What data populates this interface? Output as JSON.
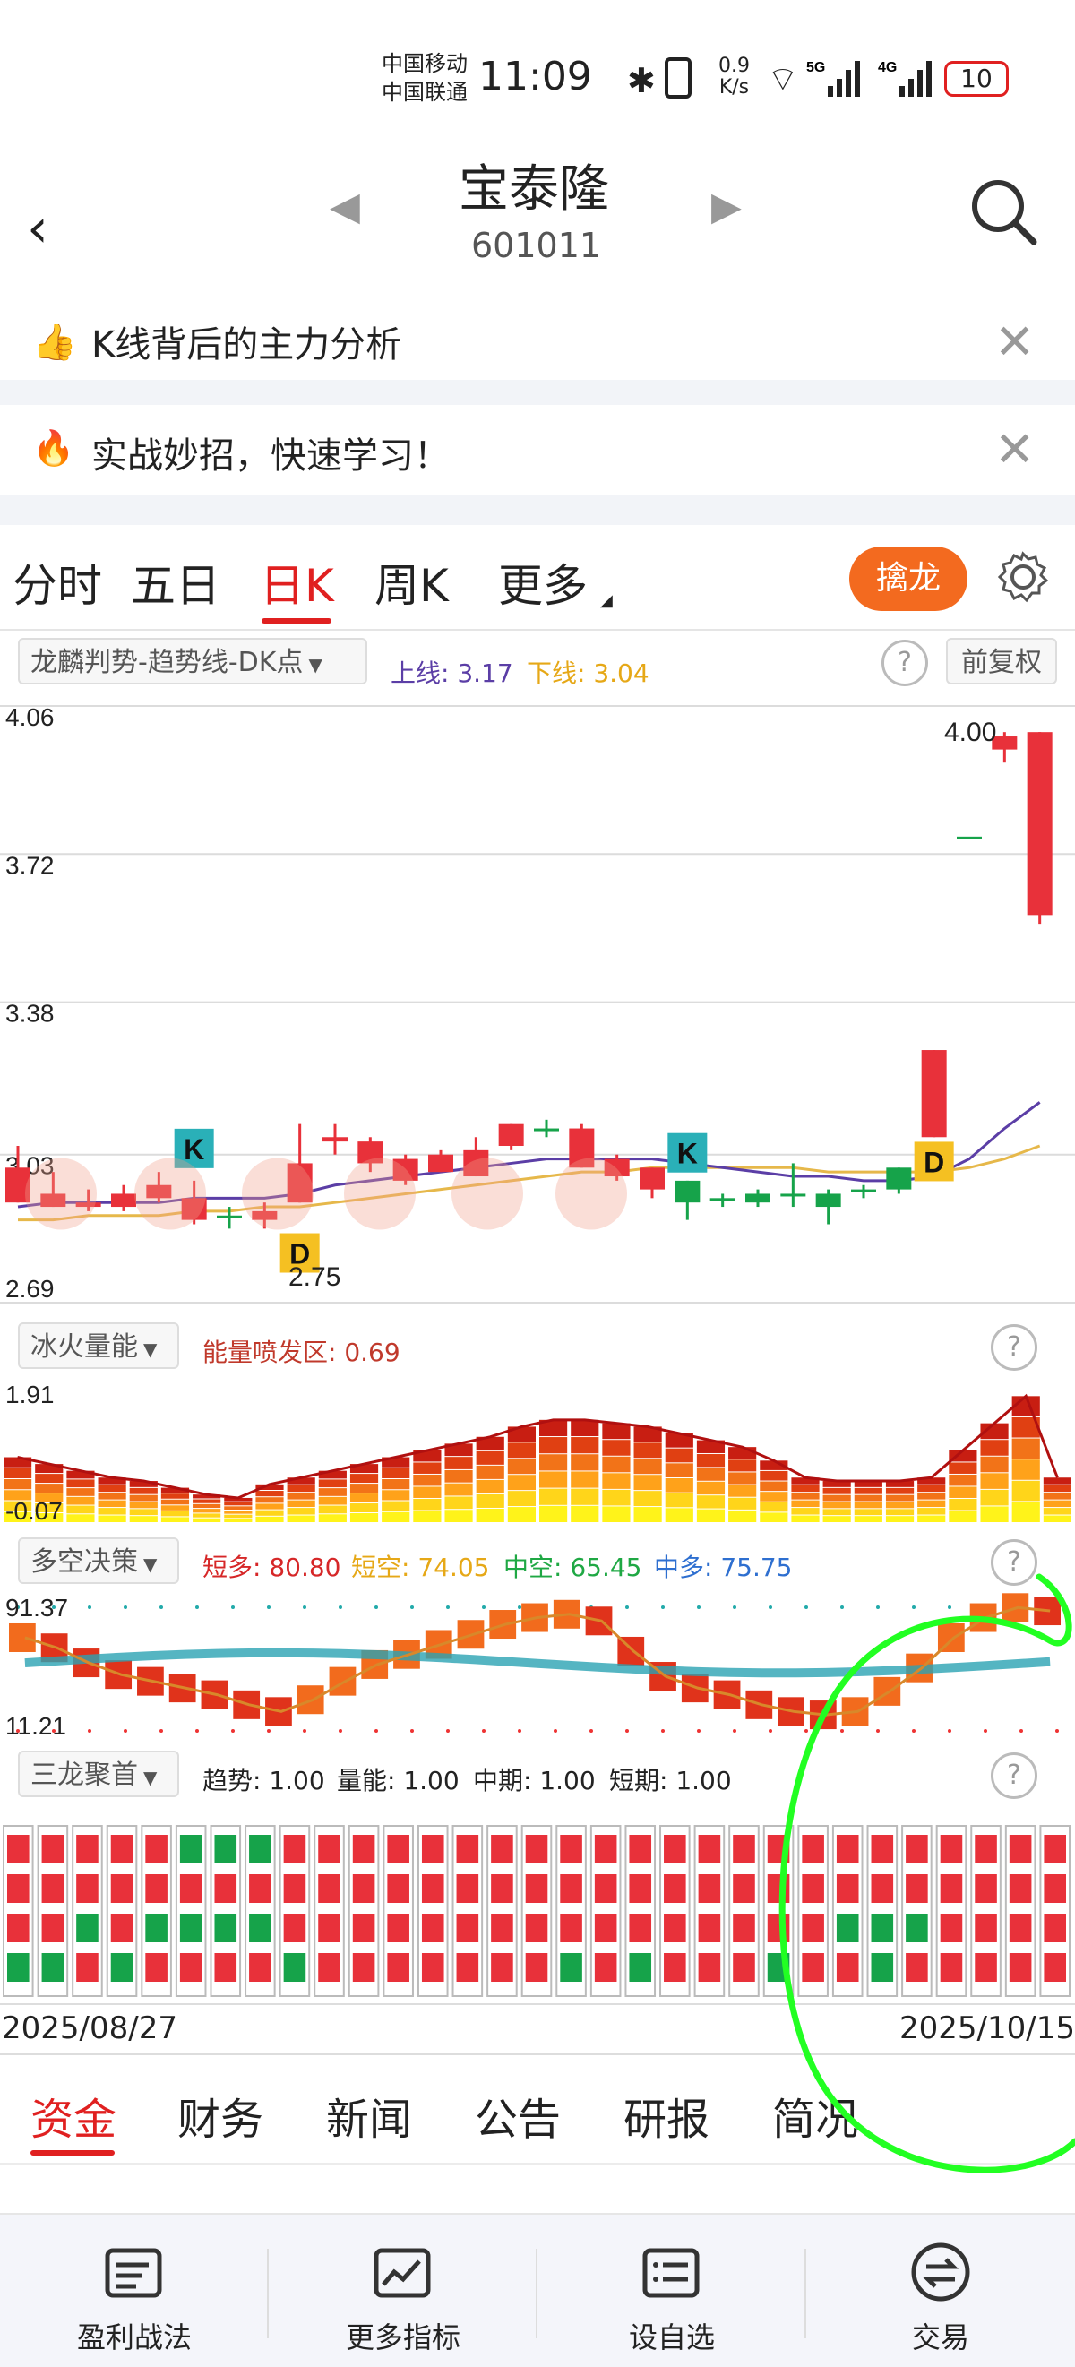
{
  "status": {
    "carrier_top": "中国移动",
    "carrier_bottom": "中国联通",
    "time": "11:09",
    "speed_value": "0.9",
    "speed_unit": "K/s",
    "battery": "10"
  },
  "header": {
    "title": "宝泰隆",
    "code": "601011"
  },
  "banners": [
    {
      "text": "K线背后的主力分析"
    },
    {
      "text": "实战妙招，快速学习！"
    }
  ],
  "period_tabs": [
    {
      "label": "分时",
      "active": false
    },
    {
      "label": "五日",
      "active": false
    },
    {
      "label": "日K",
      "active": true
    },
    {
      "label": "周K",
      "active": false
    },
    {
      "label": "更多",
      "active": false
    }
  ],
  "qinlong_label": "擒龙",
  "indicator_main": {
    "selector": "龙麟判势-趋势线-DK点",
    "upper": "上线: 3.17",
    "lower": "下线: 3.04",
    "adjust": "前复权"
  },
  "chart_data": [
    {
      "type": "candlestick",
      "ylim": [
        2.69,
        4.06
      ],
      "ticks": [
        "4.06",
        "3.72",
        "3.38",
        "3.03",
        "2.69"
      ],
      "annotations": [
        "4.00",
        "2.75",
        "K",
        "K",
        "D",
        "D"
      ],
      "candles": [
        {
          "o": 3.0,
          "h": 3.05,
          "l": 2.92,
          "c": 2.92
        },
        {
          "o": 2.94,
          "h": 2.99,
          "l": 2.91,
          "c": 2.91
        },
        {
          "o": 2.92,
          "h": 2.95,
          "l": 2.9,
          "c": 2.91
        },
        {
          "o": 2.94,
          "h": 2.96,
          "l": 2.9,
          "c": 2.91
        },
        {
          "o": 2.96,
          "h": 2.99,
          "l": 2.92,
          "c": 2.93
        },
        {
          "o": 2.93,
          "h": 2.97,
          "l": 2.87,
          "c": 2.88
        },
        {
          "o": 2.89,
          "h": 2.91,
          "l": 2.86,
          "c": 2.89
        },
        {
          "o": 2.9,
          "h": 2.92,
          "l": 2.86,
          "c": 2.88
        },
        {
          "o": 3.01,
          "h": 3.1,
          "l": 2.92,
          "c": 2.92
        },
        {
          "o": 3.07,
          "h": 3.1,
          "l": 3.03,
          "c": 3.06
        },
        {
          "o": 3.06,
          "h": 3.07,
          "l": 2.99,
          "c": 3.01
        },
        {
          "o": 3.02,
          "h": 3.03,
          "l": 2.96,
          "c": 2.97
        },
        {
          "o": 3.03,
          "h": 3.04,
          "l": 2.99,
          "c": 2.99
        },
        {
          "o": 3.04,
          "h": 3.07,
          "l": 2.98,
          "c": 2.98
        },
        {
          "o": 3.1,
          "h": 3.1,
          "l": 3.04,
          "c": 3.05
        },
        {
          "o": 3.09,
          "h": 3.11,
          "l": 3.07,
          "c": 3.09
        },
        {
          "o": 3.09,
          "h": 3.1,
          "l": 3.0,
          "c": 3.0
        },
        {
          "o": 3.02,
          "h": 3.03,
          "l": 2.97,
          "c": 2.98
        },
        {
          "o": 3.0,
          "h": 3.0,
          "l": 2.93,
          "c": 2.95
        },
        {
          "o": 2.92,
          "h": 2.97,
          "l": 2.88,
          "c": 2.97
        },
        {
          "o": 2.93,
          "h": 2.94,
          "l": 2.91,
          "c": 2.93
        },
        {
          "o": 2.92,
          "h": 2.95,
          "l": 2.91,
          "c": 2.94
        },
        {
          "o": 2.94,
          "h": 3.01,
          "l": 2.91,
          "c": 2.94
        },
        {
          "o": 2.91,
          "h": 2.95,
          "l": 2.87,
          "c": 2.94
        },
        {
          "o": 2.95,
          "h": 2.96,
          "l": 2.93,
          "c": 2.95
        },
        {
          "o": 2.95,
          "h": 3.0,
          "l": 2.94,
          "c": 3.0
        },
        {
          "o": 3.27,
          "h": 3.27,
          "l": 3.07,
          "c": 3.07
        },
        {
          "o": 3.76,
          "h": 3.76,
          "l": 3.76,
          "c": 3.76
        },
        {
          "o": 3.99,
          "h": 4.0,
          "l": 3.93,
          "c": 3.96
        },
        {
          "o": 4.0,
          "h": 4.0,
          "l": 3.56,
          "c": 3.58
        }
      ],
      "line_purple": [
        2.91,
        2.92,
        2.92,
        2.92,
        2.92,
        2.93,
        2.93,
        2.93,
        2.94,
        2.96,
        2.97,
        2.98,
        2.99,
        3.0,
        3.01,
        3.02,
        3.02,
        3.02,
        3.02,
        3.01,
        3.0,
        2.99,
        2.98,
        2.98,
        2.97,
        2.97,
        2.98,
        3.02,
        3.09,
        3.15
      ],
      "line_orange": [
        2.88,
        2.88,
        2.89,
        2.89,
        2.89,
        2.9,
        2.9,
        2.91,
        2.91,
        2.92,
        2.93,
        2.94,
        2.95,
        2.96,
        2.97,
        2.98,
        2.99,
        2.99,
        3.0,
        3.0,
        3.0,
        3.0,
        3.0,
        2.99,
        2.99,
        2.99,
        2.99,
        3.0,
        3.02,
        3.05
      ]
    },
    {
      "type": "bar",
      "title": "冰火量能",
      "label": "能量喷发区: 0.69",
      "ylim": [
        -0.07,
        1.91
      ],
      "ticks": [
        "1.91",
        "-0.07"
      ],
      "values": [
        0.9,
        0.8,
        0.7,
        0.6,
        0.55,
        0.45,
        0.35,
        0.3,
        0.5,
        0.6,
        0.7,
        0.8,
        0.9,
        1.0,
        1.1,
        1.2,
        1.35,
        1.45,
        1.45,
        1.4,
        1.35,
        1.25,
        1.15,
        1.05,
        0.85,
        0.6,
        0.55,
        0.55,
        0.55,
        0.6,
        1.0,
        1.4,
        1.8,
        0.6
      ]
    },
    {
      "type": "bar",
      "title": "多空决策",
      "ylim": [
        11.21,
        91.37
      ],
      "ticks": [
        "91.37",
        "11.21"
      ],
      "series": [
        {
          "name": "短多",
          "label": "短多: 80.80",
          "color": "#d62728"
        },
        {
          "name": "短空",
          "label": "短空: 74.05",
          "color": "#e6a817"
        },
        {
          "name": "中空",
          "label": "中空: 65.45",
          "color": "#1fa844"
        },
        {
          "name": "中多",
          "label": "中多: 75.75",
          "color": "#2e6fd0"
        }
      ],
      "values": [
        70,
        64,
        55,
        48,
        44,
        40,
        36,
        30,
        26,
        33,
        44,
        54,
        60,
        66,
        72,
        78,
        82,
        84,
        80,
        62,
        47,
        40,
        36,
        30,
        26,
        24,
        26,
        38,
        52,
        70,
        82,
        88,
        86
      ]
    },
    {
      "type": "heatmap",
      "title": "三龙聚首",
      "series": [
        {
          "name": "趋势",
          "label": "趋势: 1.00"
        },
        {
          "name": "量能",
          "label": "量能: 1.00"
        },
        {
          "name": "中期",
          "label": "中期: 1.00"
        },
        {
          "name": "短期",
          "label": "短期: 1.00"
        }
      ],
      "rows": [
        "RRRRRGGGRRRRRRRRRRRRRRRRRRRRRRR",
        "RRRRRRRRRRRRRRRRRRRRRRRRRRRRRRR",
        "RRGRGGGGRRRRRRRRRRRRRRRRGGGRRRR",
        "GGRGRRRRGRRRRRRRGRGRRRGRRGRRRRR"
      ],
      "x_start": "2025/08/27",
      "x_end": "2025/10/15"
    }
  ],
  "date_start": "2025/08/27",
  "date_end": "2025/10/15",
  "volume_indicator": {
    "selector": "冰火量能",
    "label": "能量喷发区: 0.69"
  },
  "decision_indicator": {
    "selector": "多空决策",
    "items": [
      "短多: 80.80",
      "短空: 74.05",
      "中空: 65.45",
      "中多: 75.75"
    ]
  },
  "sanlong_indicator": {
    "selector": "三龙聚首",
    "items": [
      "趋势: 1.00",
      "量能: 1.00",
      "中期: 1.00",
      "短期: 1.00"
    ]
  },
  "bottom_tabs": [
    {
      "label": "资金",
      "active": true
    },
    {
      "label": "财务",
      "active": false
    },
    {
      "label": "新闻",
      "active": false
    },
    {
      "label": "公告",
      "active": false
    },
    {
      "label": "研报",
      "active": false
    },
    {
      "label": "简况",
      "active": false
    }
  ],
  "bottom_nav": [
    {
      "label": "盈利战法",
      "icon": "document-icon"
    },
    {
      "label": "更多指标",
      "icon": "chart-icon"
    },
    {
      "label": "设自选",
      "icon": "list-icon"
    },
    {
      "label": "交易",
      "icon": "exchange-icon"
    }
  ],
  "colors": {
    "up": "#e8313a",
    "down": "#16a34a",
    "accent": "#e02020",
    "pill": "#f36a1f",
    "annotation": "#22ff22"
  }
}
